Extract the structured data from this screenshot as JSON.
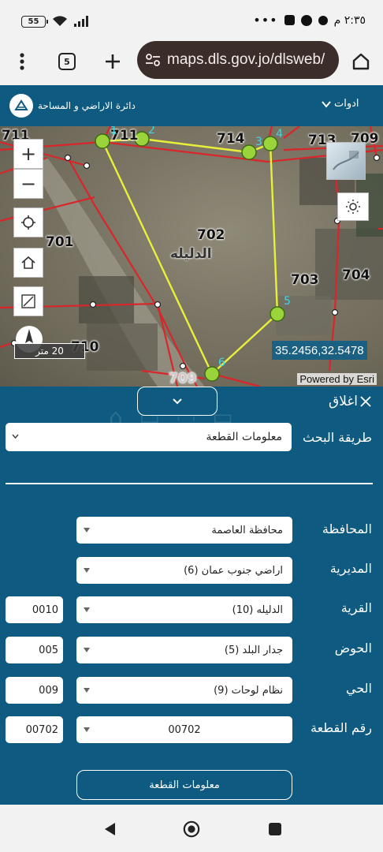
{
  "status_bar": {
    "time": "٢:٣٥ م",
    "battery": "55"
  },
  "browser": {
    "url": "maps.dls.gov.jo/dlsweb/",
    "tab_count": "5"
  },
  "app_header": {
    "tools_label": "ادوات",
    "brand_name": "دائرة الاراضي و المساحة"
  },
  "map": {
    "parcel_labels": [
      "711",
      "711",
      "714",
      "713",
      "709",
      "701",
      "702",
      "703",
      "704",
      "710",
      "709"
    ],
    "vertex_labels": [
      "1",
      "2",
      "3",
      "4",
      "5",
      "6"
    ],
    "village_name": "الدليله",
    "scale": "20 متر",
    "coordinates": "35.2456,32.5478",
    "attribution": "Powered by Esri",
    "icons": [
      "zoom-in-icon",
      "zoom-out-icon",
      "locate-icon",
      "home-icon",
      "measure-icon",
      "compass-icon",
      "basemap-icon",
      "brightness-icon"
    ]
  },
  "panel": {
    "close_label": "اغلاق",
    "search_method_label": "طريقة البحث",
    "search_method_value": "معلومات القطعة",
    "fields": [
      {
        "label": "المحافظة",
        "value": "محافظة العاصمة",
        "code": ""
      },
      {
        "label": "المديرية",
        "value": "اراضي جنوب عمان (6)",
        "code": ""
      },
      {
        "label": "القرية",
        "value": "الدليله (10)",
        "code": "0010"
      },
      {
        "label": "الحوض",
        "value": "جدار البلد (5)",
        "code": "005"
      },
      {
        "label": "الحي",
        "value": "نظام لوحات (9)",
        "code": "009"
      },
      {
        "label": "رقم القطعة",
        "value": "00702",
        "code": "00702"
      }
    ],
    "submit_label": "معلومات القطعة"
  },
  "colors": {
    "primary": "#0e5a80",
    "parcel_outline": "#e8f03a",
    "boundary": "#d8262a",
    "vertex": "#9bd33a"
  }
}
